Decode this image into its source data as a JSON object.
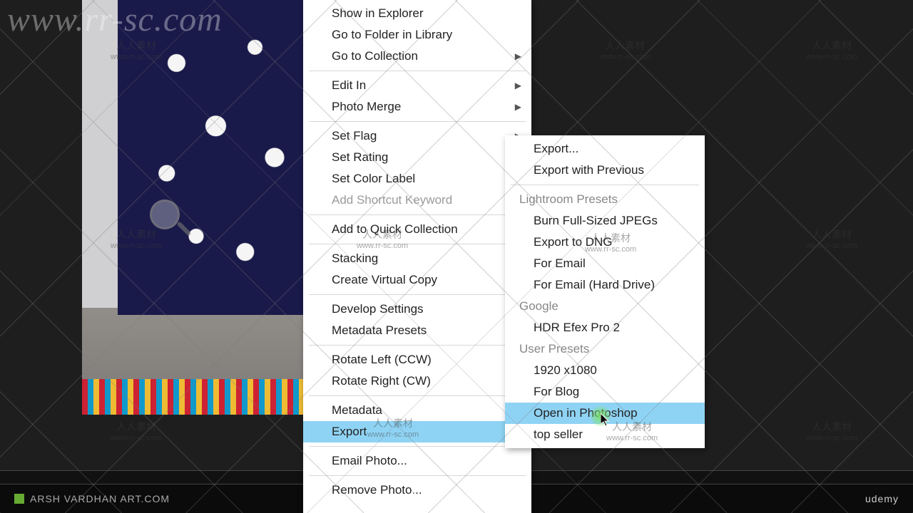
{
  "watermark": {
    "url_big": "www.rr-sc.com",
    "label": "人人素材",
    "label_sub": "www.rr-sc.com",
    "bottom": "人人素材"
  },
  "footer": {
    "left": "ARSH VARDHAN ART.COM",
    "right": "udemy"
  },
  "menu": {
    "items": [
      {
        "label": "Show in Explorer",
        "arrow": false
      },
      {
        "label": "Go to Folder in Library",
        "arrow": false
      },
      {
        "label": "Go to Collection",
        "arrow": true
      },
      {
        "sep": true
      },
      {
        "label": "Edit In",
        "arrow": true
      },
      {
        "label": "Photo Merge",
        "arrow": true
      },
      {
        "sep": true
      },
      {
        "label": "Set Flag",
        "arrow": true
      },
      {
        "label": "Set Rating",
        "arrow": true
      },
      {
        "label": "Set Color Label",
        "arrow": true
      },
      {
        "label": "Add Shortcut Keyword",
        "arrow": false,
        "disabled": true
      },
      {
        "sep": true
      },
      {
        "label": "Add to Quick Collection",
        "arrow": false
      },
      {
        "sep": true
      },
      {
        "label": "Stacking",
        "arrow": true
      },
      {
        "label": "Create Virtual Copy",
        "arrow": false
      },
      {
        "sep": true
      },
      {
        "label": "Develop Settings",
        "arrow": true
      },
      {
        "label": "Metadata Presets",
        "arrow": true
      },
      {
        "sep": true
      },
      {
        "label": "Rotate Left (CCW)",
        "arrow": false
      },
      {
        "label": "Rotate Right (CW)",
        "arrow": false
      },
      {
        "sep": true
      },
      {
        "label": "Metadata",
        "arrow": true
      },
      {
        "label": "Export",
        "arrow": true,
        "highlight": true
      },
      {
        "sep": true
      },
      {
        "label": "Email Photo...",
        "arrow": false
      },
      {
        "sep": true
      },
      {
        "label": "Remove Photo...",
        "arrow": false
      }
    ]
  },
  "submenu": {
    "top": [
      {
        "label": "Export..."
      },
      {
        "label": "Export with Previous"
      }
    ],
    "sections": [
      {
        "header": "Lightroom Presets",
        "items": [
          {
            "label": "Burn Full-Sized JPEGs"
          },
          {
            "label": "Export to DNG"
          },
          {
            "label": "For Email"
          },
          {
            "label": "For Email (Hard Drive)"
          }
        ]
      },
      {
        "header": "Google",
        "items": [
          {
            "label": "HDR Efex Pro 2"
          }
        ]
      },
      {
        "header": "User Presets",
        "items": [
          {
            "label": "1920 x1080"
          },
          {
            "label": "For Blog"
          },
          {
            "label": "Open in Photoshop",
            "highlight": true
          },
          {
            "label": "top seller"
          }
        ]
      }
    ]
  }
}
